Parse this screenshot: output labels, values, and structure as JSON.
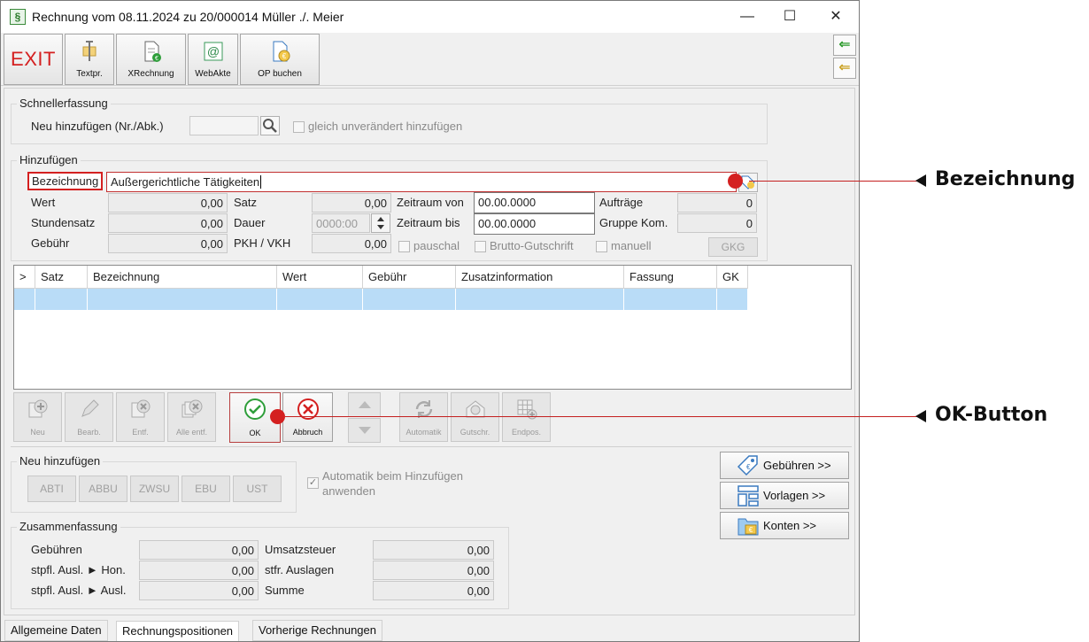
{
  "window": {
    "app_icon": "§",
    "title": "Rechnung vom 08.11.2024 zu 20/000014  Müller ./. Meier",
    "minimize_glyph": "—",
    "maximize_glyph": "☐",
    "close_glyph": "✕"
  },
  "toolbar": {
    "exit_label": "EXIT",
    "buttons": [
      {
        "label": "Textpr.",
        "icon": "text-processing-icon"
      },
      {
        "label": "XRechnung",
        "icon": "xrechnung-icon"
      },
      {
        "label": "WebAkte",
        "icon": "webakte-icon"
      },
      {
        "label": "OP buchen",
        "icon": "op-buchen-icon"
      }
    ],
    "side_buttons": [
      {
        "glyph": "⇐",
        "icon": "arrow-left-icon"
      },
      {
        "glyph": "⇐",
        "icon": "arrow-left-yellow-icon"
      }
    ]
  },
  "schnellerfassung": {
    "title": "Schnellerfassung",
    "label": "Neu hinzufügen (Nr./Abk.)",
    "input_value": "",
    "search_icon": "search-icon",
    "checkbox_label": "gleich unverändert hinzufügen"
  },
  "hinzufuegen": {
    "title": "Hinzufügen",
    "bezeichnung_label": "Bezeichnung",
    "bezeichnung_value": "Außergerichtliche Tätigkeiten",
    "wert_label": "Wert",
    "wert_value": "0,00",
    "stundensatz_label": "Stundensatz",
    "stundensatz_value": "0,00",
    "gebuehr_label": "Gebühr",
    "gebuehr_value": "0,00",
    "satz_label": "Satz",
    "satz_value": "0,00",
    "dauer_label": "Dauer",
    "dauer_value": "0000:00",
    "pkh_label": "PKH / VKH",
    "pkh_value": "0,00",
    "zeitraum_von_label": "Zeitraum von",
    "zeitraum_von_value": "00.00.0000",
    "zeitraum_bis_label": "Zeitraum bis",
    "zeitraum_bis_value": "00.00.0000",
    "auftraege_label": "Aufträge",
    "auftraege_value": "0",
    "gruppe_label": "Gruppe Kom.",
    "gruppe_value": "0",
    "pauschal_label": "pauschal",
    "brutto_label": "Brutto-Gutschrift",
    "manuell_label": "manuell",
    "gkg_label": "GKG"
  },
  "table": {
    "columns": [
      "> ",
      "Satz",
      "Bezeichnung",
      "Wert",
      "Gebühr",
      "Zusatzinformation",
      "Fassung",
      "GK"
    ]
  },
  "actions": [
    {
      "label": "Neu",
      "icon": "add-icon"
    },
    {
      "label": "Bearb.",
      "icon": "edit-icon"
    },
    {
      "label": "Entf.",
      "icon": "delete-icon"
    },
    {
      "label": "Alle entf.",
      "icon": "delete-all-icon"
    },
    {
      "label": "OK",
      "icon": "checkmark-icon"
    },
    {
      "label": "Abbruch",
      "icon": "cancel-icon"
    },
    {
      "label": "",
      "icon": "arrow-up-icon"
    },
    {
      "label": "",
      "icon": "arrow-down-icon"
    },
    {
      "label": "Automatik",
      "icon": "refresh-icon"
    },
    {
      "label": "Gutschr.",
      "icon": "credit-icon"
    },
    {
      "label": "Endpos.",
      "icon": "grid-add-icon"
    }
  ],
  "neu_hinzufuegen": {
    "title": "Neu hinzufügen",
    "buttons": [
      "ABTI",
      "ABBU",
      "ZWSU",
      "EBU",
      "UST"
    ],
    "automatik_label": "Automatik beim Hinzufügen anwenden",
    "automatik_checked": "✓"
  },
  "side_actions": [
    {
      "label": "Gebühren >>",
      "icon": "tag-icon"
    },
    {
      "label": "Vorlagen >>",
      "icon": "template-icon"
    },
    {
      "label": "Konten >>",
      "icon": "accounts-folder-icon"
    }
  ],
  "zusammenfassung": {
    "title": "Zusammenfassung",
    "gebuehren_label": "Gebühren",
    "gebuehren_value": "0,00",
    "stpfl_hon_label": "stpfl. Ausl. ► Hon.",
    "stpfl_hon_value": "0,00",
    "stpfl_ausl_label": "stpfl. Ausl. ► Ausl.",
    "stpfl_ausl_value": "0,00",
    "ust_label": "Umsatzsteuer",
    "ust_value": "0,00",
    "stfr_label": "stfr. Auslagen",
    "stfr_value": "0,00",
    "summe_label": "Summe",
    "summe_value": "0,00"
  },
  "tabs": [
    "Allgemeine Daten",
    "Rechnungspositionen",
    "Vorherige Rechnungen"
  ],
  "callouts": {
    "bezeichnung": "Bezeichnung",
    "ok_button": "OK-Button"
  },
  "colors": {
    "accent_red": "#d42020",
    "selection_blue": "#b9dcf7",
    "ok_green": "#2e9e3a"
  }
}
